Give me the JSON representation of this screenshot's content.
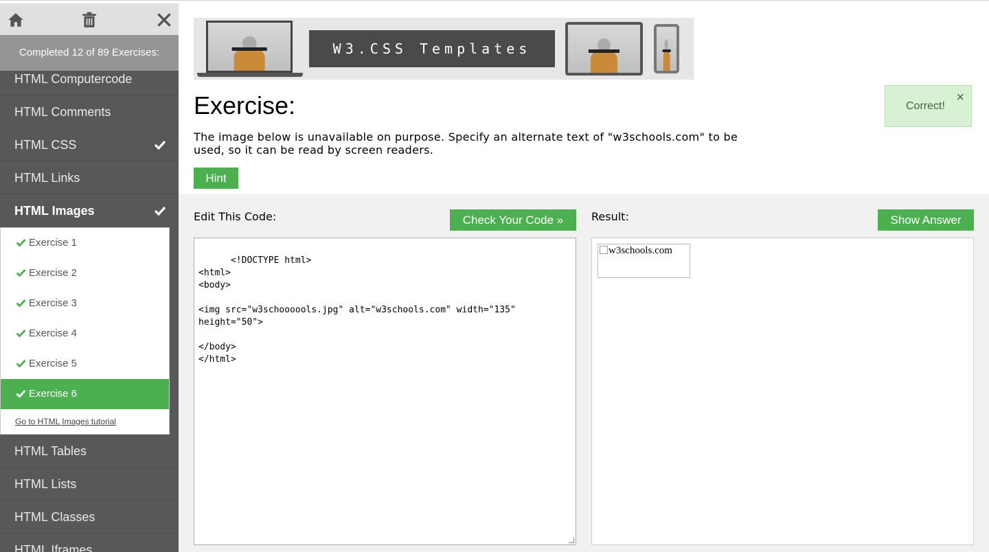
{
  "sidebar": {
    "progress_text": "Completed 12 of 89 Exercises:",
    "items_before": [
      {
        "label": "HTML Computercode",
        "checked": false
      },
      {
        "label": "HTML Comments",
        "checked": false
      },
      {
        "label": "HTML CSS",
        "checked": true
      },
      {
        "label": "HTML Links",
        "checked": false
      },
      {
        "label": "HTML Images",
        "checked": true,
        "active": true
      }
    ],
    "exercises": [
      {
        "label": "Exercise 1"
      },
      {
        "label": "Exercise 2"
      },
      {
        "label": "Exercise 3"
      },
      {
        "label": "Exercise 4"
      },
      {
        "label": "Exercise 5"
      },
      {
        "label": "Exercise 6",
        "current": true
      }
    ],
    "tutorial_link": "Go to HTML Images tutorial",
    "items_after": [
      {
        "label": "HTML Tables"
      },
      {
        "label": "HTML Lists"
      },
      {
        "label": "HTML Classes"
      },
      {
        "label": "HTML Iframes"
      }
    ]
  },
  "banner": {
    "title": "W3.CSS Templates"
  },
  "exercise": {
    "title": "Exercise:",
    "description": "The image below is unavailable on purpose. Specify an alternate text of \"w3schools.com\" to be used, so it can be read by screen readers.",
    "hint_label": "Hint"
  },
  "alert": {
    "message": "Correct!",
    "close": "×"
  },
  "workspace": {
    "edit_label": "Edit This Code:",
    "check_label": "Check Your Code »",
    "result_label": "Result:",
    "answer_label": "Show Answer",
    "code": "<!DOCTYPE html>\n<html>\n<body>\n\n<img src=\"w3schoooools.jpg\" alt=\"w3schools.com\" width=\"135\"\nheight=\"50\">\n\n</body>\n</html>",
    "result_alt_text": "w3schools.com"
  },
  "colors": {
    "accent_green": "#4caf50",
    "sidebar_bg": "#585858",
    "alert_bg": "#d8f0d3"
  }
}
